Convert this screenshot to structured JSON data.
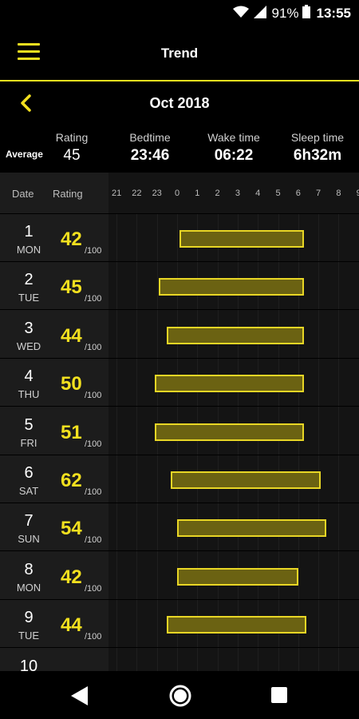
{
  "status": {
    "battery": "91%",
    "time": "13:55"
  },
  "app": {
    "title": "Trend"
  },
  "nav": {
    "month": "Oct 2018"
  },
  "summary": {
    "average_label": "Average",
    "rating": {
      "label": "Rating",
      "value": "45"
    },
    "bedtime": {
      "label": "Bedtime",
      "value": "23:46"
    },
    "wake": {
      "label": "Wake time",
      "value": "06:22"
    },
    "sleep": {
      "label": "Sleep time",
      "value": "6h32m"
    }
  },
  "grid": {
    "date_header": "Date",
    "rating_header": "Rating",
    "hours": [
      "21",
      "22",
      "23",
      "0",
      "1",
      "2",
      "3",
      "4",
      "5",
      "6",
      "7",
      "8",
      "9"
    ],
    "out_of": "/100",
    "rows": [
      {
        "day": "1",
        "weekday": "MON",
        "rating": "42",
        "start_hour": 0.1,
        "end_hour": 6.3
      },
      {
        "day": "2",
        "weekday": "TUE",
        "rating": "45",
        "start_hour": -0.9,
        "end_hour": 6.3
      },
      {
        "day": "3",
        "weekday": "WED",
        "rating": "44",
        "start_hour": -0.5,
        "end_hour": 6.3
      },
      {
        "day": "4",
        "weekday": "THU",
        "rating": "50",
        "start_hour": -1.1,
        "end_hour": 6.3
      },
      {
        "day": "5",
        "weekday": "FRI",
        "rating": "51",
        "start_hour": -1.1,
        "end_hour": 6.3
      },
      {
        "day": "6",
        "weekday": "SAT",
        "rating": "62",
        "start_hour": -0.3,
        "end_hour": 7.1
      },
      {
        "day": "7",
        "weekday": "SUN",
        "rating": "54",
        "start_hour": 0.0,
        "end_hour": 7.4
      },
      {
        "day": "8",
        "weekday": "MON",
        "rating": "42",
        "start_hour": 0.0,
        "end_hour": 6.0
      },
      {
        "day": "9",
        "weekday": "TUE",
        "rating": "44",
        "start_hour": -0.5,
        "end_hour": 6.4
      },
      {
        "day": "10",
        "weekday": "",
        "rating": "",
        "start_hour": null,
        "end_hour": null
      }
    ]
  },
  "colors": {
    "accent": "#f2e01f",
    "bar_fill": "#6b6212",
    "bar_border": "#e8d625"
  },
  "icons": [
    "wifi-icon",
    "signal-icon",
    "battery-icon",
    "menu-icon",
    "back-arrow-icon",
    "nav-back-icon",
    "nav-home-icon",
    "nav-recents-icon"
  ]
}
